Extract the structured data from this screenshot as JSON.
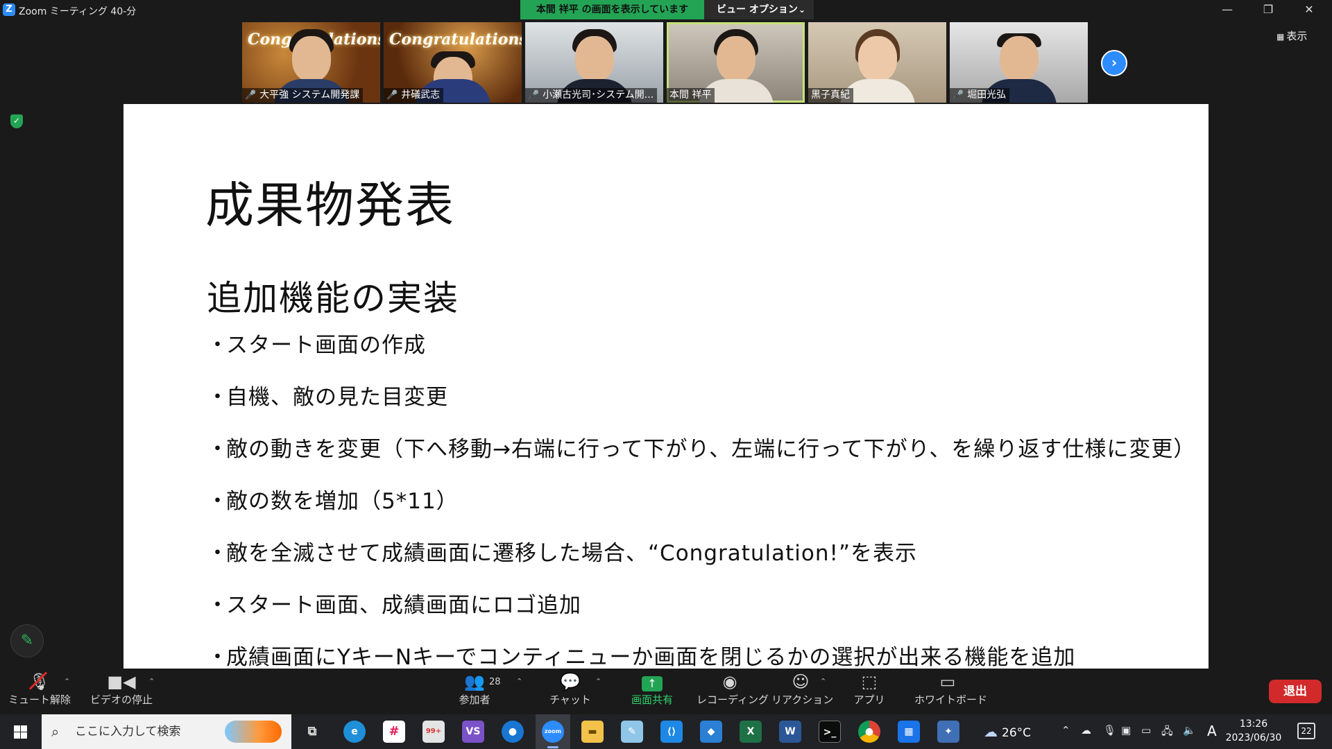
{
  "window": {
    "app_icon": "Z",
    "title": "Zoom ミーティング 40-分",
    "share_banner": "本間 祥平 の画面を表示しています",
    "view_options": "ビュー オプション",
    "controls": [
      "minimize-icon",
      "restore-icon",
      "close-icon"
    ]
  },
  "participants_strip": [
    {
      "name": "大平強 システム開発課",
      "muted": true,
      "background": "Congratulations!",
      "active": false
    },
    {
      "name": "井礒武志",
      "muted": true,
      "background": "Congratulations!",
      "active": false
    },
    {
      "name": "小瀬古光司･システム開...",
      "muted": true,
      "background": "",
      "active": false
    },
    {
      "name": "本間 祥平",
      "muted": false,
      "background": "",
      "active": true
    },
    {
      "name": "黒子真紀",
      "muted": false,
      "background": "",
      "active": false
    },
    {
      "name": "堀田光弘",
      "muted": true,
      "background": "",
      "active": false
    }
  ],
  "view_toggle": "表示",
  "slide": {
    "title": "成果物発表",
    "subtitle": "追加機能の実装",
    "bullet_marker": "・",
    "bullets": [
      "スタート画面の作成",
      "自機、敵の見た目変更",
      "敵の動きを変更（下へ移動→右端に行って下がり、左端に行って下がり、を繰り返す仕様に変更）",
      "敵の数を増加（5*11）",
      "敵を全滅させて成績画面に遷移した場合、“Congratulation!”を表示",
      "スタート画面、成績画面にロゴ追加",
      "成績画面にYキーNキーでコンティニューか画面を閉じるかの選択が出来る機能を追加"
    ]
  },
  "toolbar": {
    "unmute": "ミュート解除",
    "stop_video": "ビデオの停止",
    "participants": "参加者",
    "participants_count": "28",
    "chat": "チャット",
    "share_screen": "画面共有",
    "recording": "レコーディング",
    "reactions": "リアクション",
    "apps": "アプリ",
    "whiteboard": "ホワイトボード",
    "leave": "退出"
  },
  "taskbar": {
    "search_placeholder": "ここに入力して検索",
    "weather": "26°C",
    "ime": "A",
    "time": "13:26",
    "date": "2023/06/30",
    "notifications": "22",
    "apps": [
      "task-view",
      "edge",
      "slack",
      "mail-99plus",
      "visual-studio",
      "maps",
      "zoom",
      "file-explorer",
      "notes",
      "vscode",
      "store",
      "excel",
      "word",
      "terminal",
      "chrome",
      "calendar",
      "zip-tool"
    ]
  },
  "colors": {
    "accent_blue": "#2d8cff",
    "share_green": "#23a455",
    "leave_red": "#d22a2a",
    "active_speaker": "#c4e27a"
  }
}
